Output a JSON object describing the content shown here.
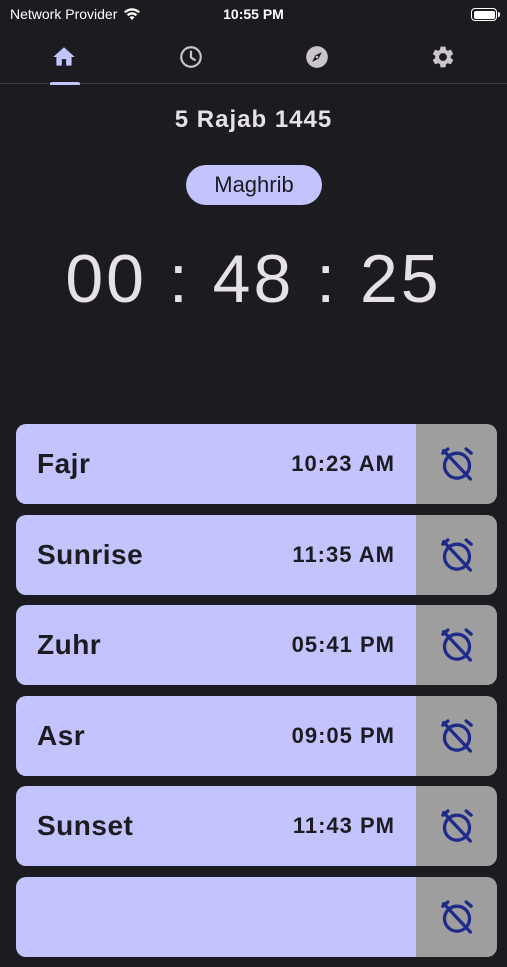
{
  "status_bar": {
    "carrier": "Network Provider",
    "time": "10:55 PM"
  },
  "nav": {
    "tabs": [
      {
        "name": "home",
        "icon": "home-icon",
        "active": true
      },
      {
        "name": "clock",
        "icon": "clock-icon",
        "active": false
      },
      {
        "name": "compass",
        "icon": "compass-icon",
        "active": false
      },
      {
        "name": "settings",
        "icon": "gear-icon",
        "active": false
      }
    ]
  },
  "header": {
    "hijri_date": "5 Rajab 1445",
    "next_prayer": "Maghrib",
    "countdown": "00 : 48 : 25"
  },
  "prayers": [
    {
      "name": "Fajr",
      "time": "10:23 AM"
    },
    {
      "name": "Sunrise",
      "time": "11:35 AM"
    },
    {
      "name": "Zuhr",
      "time": "05:41 PM"
    },
    {
      "name": "Asr",
      "time": "09:05 PM"
    },
    {
      "name": "Sunset",
      "time": "11:43 PM"
    },
    {
      "name": "",
      "time": ""
    }
  ],
  "colors": {
    "background": "#1c1b1f",
    "accent": "#c3c3ff",
    "alarm_bg": "#9e9e9e",
    "alarm_icon": "#1f2a8a"
  }
}
